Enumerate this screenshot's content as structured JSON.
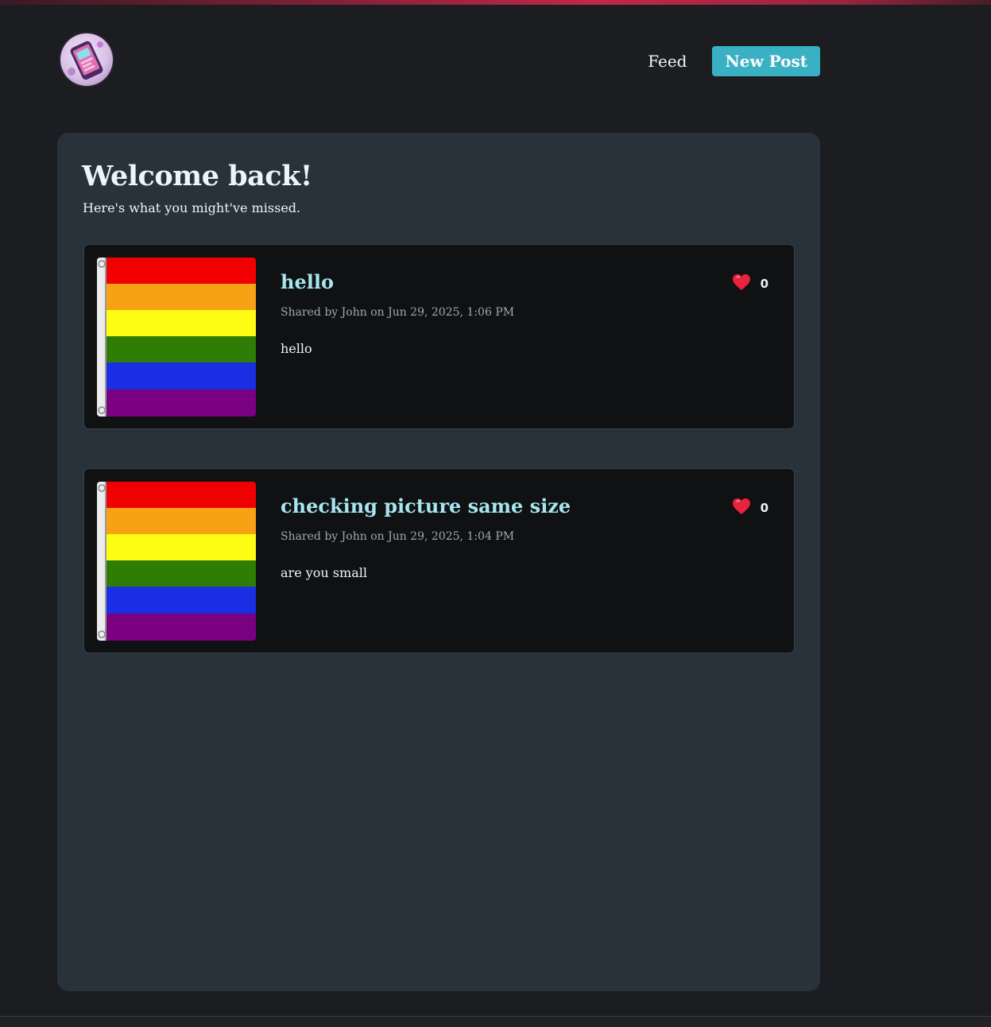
{
  "header": {
    "logo_icon": "phone-app-logo-icon",
    "nav": {
      "feed_label": "Feed",
      "new_post_label": "New Post"
    }
  },
  "main": {
    "title": "Welcome back!",
    "subtitle": "Here's what you might've missed."
  },
  "colors": {
    "accent": "#3ab0c4",
    "post_title": "#a6e6f0",
    "like_heart": "#e8233f",
    "flag_stripes": [
      "#f00000",
      "#f7a114",
      "#fffc14",
      "#2f7d05",
      "#1a2ee3",
      "#790080"
    ]
  },
  "posts": [
    {
      "title": "hello",
      "meta": "Shared by John on Jun 29, 2025, 1:06 PM",
      "body": "hello",
      "likes": "0",
      "image_icon": "rainbow-flag-image"
    },
    {
      "title": "checking picture same size",
      "meta": "Shared by John on Jun 29, 2025, 1:04 PM",
      "body": "are you small",
      "likes": "0",
      "image_icon": "rainbow-flag-image"
    }
  ]
}
